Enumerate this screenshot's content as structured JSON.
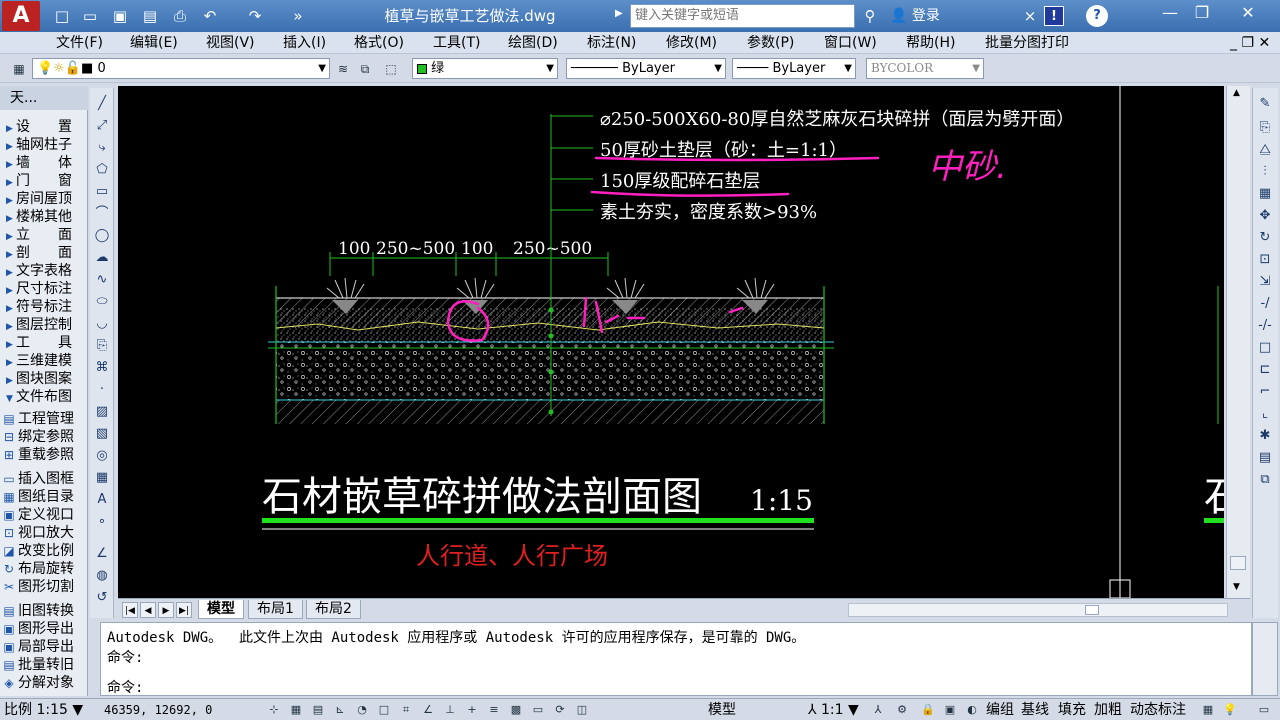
{
  "titlebar": {
    "app_logo": "A",
    "document_title": "植草与嵌草工艺做法.dwg",
    "search_placeholder": "键入关键字或短语",
    "login_label": "登录"
  },
  "menu": [
    "文件(F)",
    "编辑(E)",
    "视图(V)",
    "插入(I)",
    "格式(O)",
    "工具(T)",
    "绘图(D)",
    "标注(N)",
    "修改(M)",
    "参数(P)",
    "窗口(W)",
    "帮助(H)",
    "批量分图打印"
  ],
  "layer_toolbar": {
    "layer_value": "0",
    "color_value": "绿",
    "linetype_value": "ByLayer",
    "lineweight_value": "ByLayer",
    "plotstyle_value": "BYCOLOR"
  },
  "side_panel": {
    "title": "天...",
    "items": [
      "设　　置",
      "轴网柱子",
      "墙　　体",
      "门　　窗",
      "房间屋顶",
      "楼梯其他",
      "立　　面",
      "剖　　面",
      "文字表格",
      "尺寸标注",
      "符号标注",
      "图层控制",
      "工　　具",
      "三维建模",
      "图块图案",
      "文件布图"
    ],
    "tool_items": [
      "工程管理",
      "绑定参照",
      "重载参照",
      "插入图框",
      "图纸目录",
      "定义视口",
      "视口放大",
      "改变比例",
      "布局旋转",
      "图形切割",
      "旧图转换",
      "图形导出",
      "局部导出",
      "批量转旧",
      "分解对象"
    ]
  },
  "drawing": {
    "callouts": [
      "⌀250-500X60-80厚自然芝麻灰石块碎拼（面层为劈开面）",
      "50厚砂土垫层（砂：土=1:1）",
      "150厚级配碎石垫层",
      "素土夯实，密度系数>93%"
    ],
    "dimensions": [
      "100",
      "250~500",
      "100",
      "250~500"
    ],
    "title": "石材嵌草碎拼做法剖面图",
    "scale": "1:15",
    "subtitle": "人行道、人行广场",
    "annotation": "中砂.",
    "partial_next_title": "石",
    "colors": {
      "callout_text": "#ffffff",
      "title_underline": "#20e020",
      "subtitle": "#e02020",
      "markup": "#ff20c0",
      "leader": "#20d040"
    }
  },
  "tabs": [
    "模型",
    "布局1",
    "布局2"
  ],
  "command": {
    "line1": "Autodesk DWG。  此文件上次由 Autodesk 应用程序或 Autodesk 许可的应用程序保存，是可靠的 DWG。",
    "line2": "命令:",
    "line3": "命令:"
  },
  "status": {
    "scale": "比例 1:15",
    "coordinates": "46359, 12692, 0",
    "model_label": "模型",
    "annotation_scale": "1:1",
    "buttons": [
      "编组",
      "基线",
      "填充",
      "加粗",
      "动态标注"
    ]
  }
}
